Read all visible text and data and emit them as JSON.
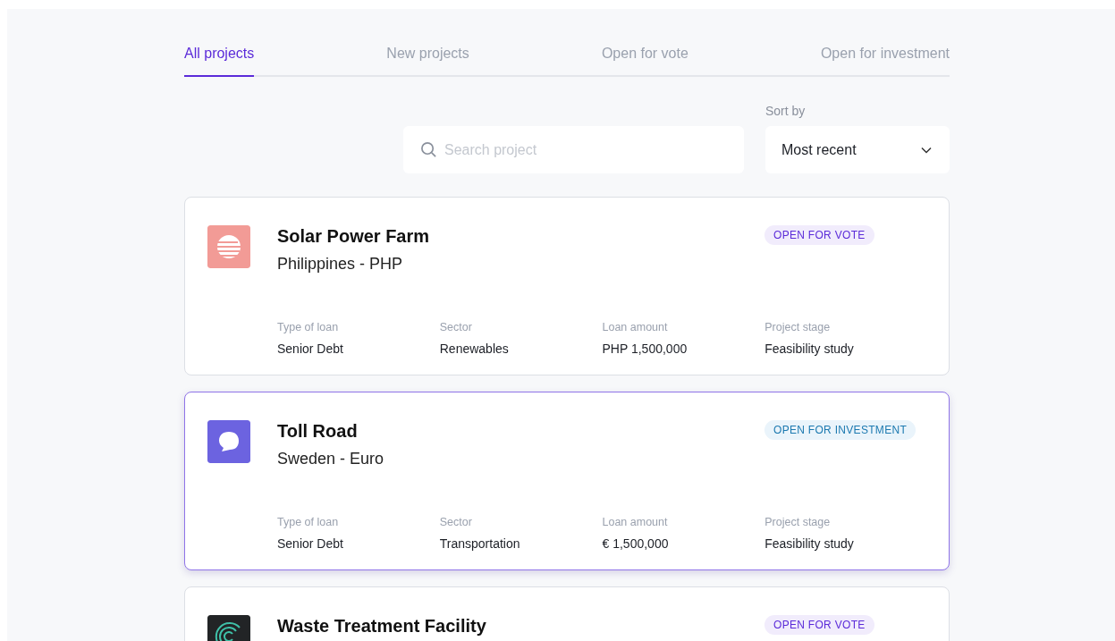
{
  "tabs": [
    {
      "label": "All projects",
      "selected": true
    },
    {
      "label": "New projects",
      "selected": false
    },
    {
      "label": "Open for vote",
      "selected": false
    },
    {
      "label": "Open for investment",
      "selected": false
    }
  ],
  "search": {
    "placeholder": "Search project"
  },
  "sort": {
    "label": "Sort by",
    "value": "Most recent"
  },
  "projects": [
    {
      "title": "Solar Power Farm",
      "subtitle": "Philippines - PHP",
      "logo": {
        "kind": "globe",
        "color": "#f29b96"
      },
      "status": {
        "kind": "vote",
        "label": "OPEN FOR VOTE"
      },
      "highlighted": false,
      "details": [
        {
          "label": "Type of loan",
          "value": "Senior Debt"
        },
        {
          "label": "Sector",
          "value": "Renewables"
        },
        {
          "label": "Loan amount",
          "value": "PHP 1,500,000"
        },
        {
          "label": "Project stage",
          "value": "Feasibility study"
        }
      ]
    },
    {
      "title": "Toll Road",
      "subtitle": "Sweden - Euro",
      "logo": {
        "kind": "chat",
        "color": "#6c63e0"
      },
      "status": {
        "kind": "investment",
        "label": "OPEN FOR INVESTMENT"
      },
      "highlighted": true,
      "details": [
        {
          "label": "Type of loan",
          "value": "Senior Debt"
        },
        {
          "label": "Sector",
          "value": "Transportation"
        },
        {
          "label": "Loan amount",
          "value": "€ 1,500,000"
        },
        {
          "label": "Project stage",
          "value": "Feasibility study"
        }
      ]
    },
    {
      "title": "Waste Treatment Facility",
      "logo": {
        "kind": "rings",
        "color": "#222426"
      },
      "status": {
        "kind": "vote",
        "label": "OPEN FOR VOTE"
      },
      "highlighted": false
    }
  ]
}
